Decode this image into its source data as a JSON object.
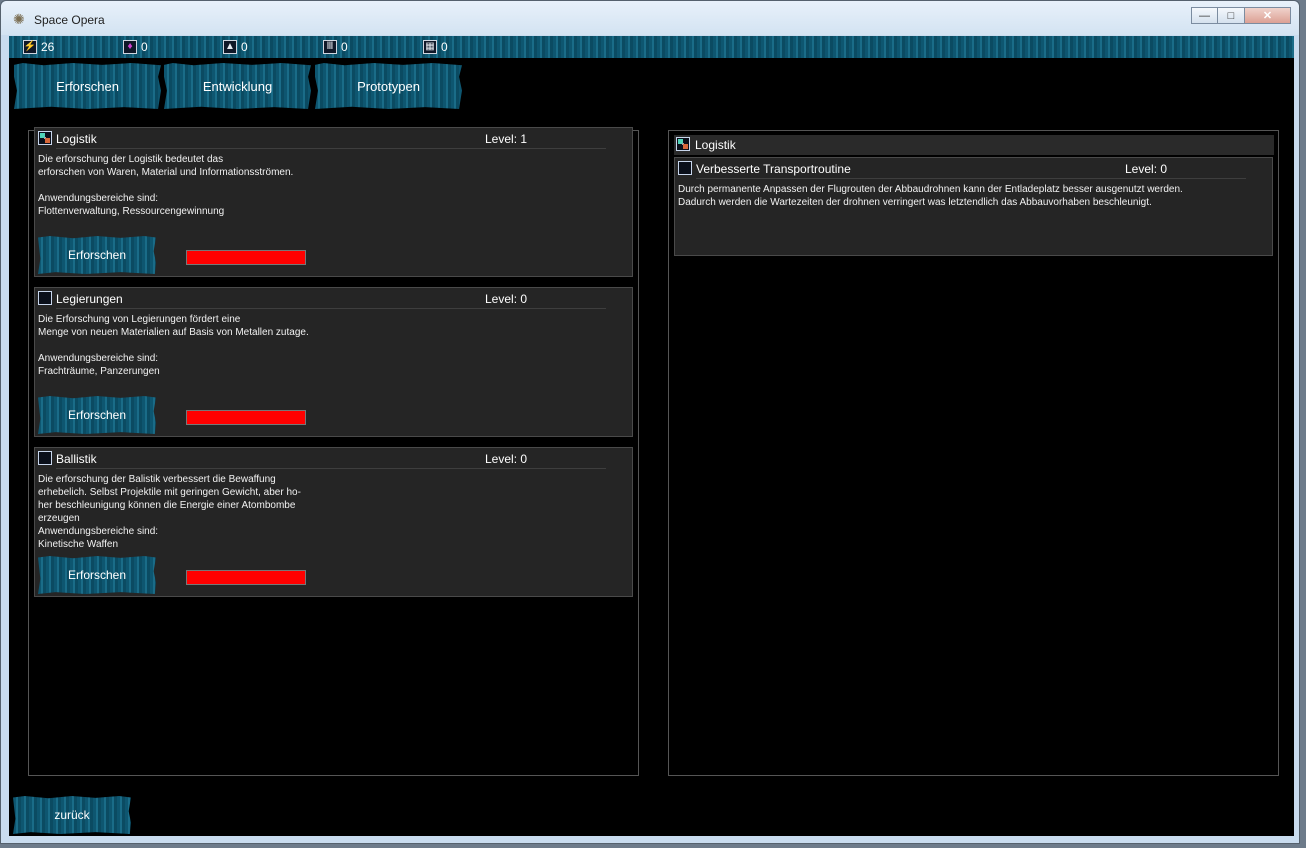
{
  "window": {
    "title": "Space Opera",
    "minimize": "—",
    "maximize": "□",
    "close": "✕"
  },
  "resources": [
    {
      "icon": "energy-icon",
      "glyph": "⚡",
      "value": "26"
    },
    {
      "icon": "crystal-icon",
      "glyph": "♦",
      "value": "0"
    },
    {
      "icon": "pyramid-icon",
      "glyph": "▲",
      "value": "0"
    },
    {
      "icon": "columns-icon",
      "glyph": "Ⅲ",
      "value": "0"
    },
    {
      "icon": "grid-icon",
      "glyph": "▦",
      "value": "0"
    }
  ],
  "tabs": [
    "Erforschen",
    "Entwicklung",
    "Prototypen"
  ],
  "research": [
    {
      "title": "Logistik",
      "level": "Level: 1",
      "checked": true,
      "desc": "Die erforschung der Logistik bedeutet das\nerforschen von Waren, Material und Informationsströmen.\n\nAnwendungsbereiche sind:\nFlottenverwaltung, Ressourcengewinnung",
      "button": "Erforschen"
    },
    {
      "title": "Legierungen",
      "level": "Level: 0",
      "checked": false,
      "desc": "Die Erforschung von Legierungen fördert eine\nMenge von neuen Materialien auf Basis von Metallen zutage.\n\nAnwendungsbereiche sind:\nFrachträume, Panzerungen",
      "button": "Erforschen"
    },
    {
      "title": "Ballistik",
      "level": "Level: 0",
      "checked": false,
      "desc": "Die erforschung der Balistik verbessert die Bewaffung\nerhebelich. Selbst Projektile mit geringen Gewicht, aber ho-\nher beschleunigung können die Energie einer Atombombe\nerzeugen\nAnwendungsbereiche sind:\nKinetische Waffen",
      "button": "Erforschen"
    }
  ],
  "detail": {
    "header": "Logistik",
    "sub": {
      "title": "Verbesserte Transportroutine",
      "level": "Level: 0",
      "desc": "Durch permanente Anpassen der Flugrouten der Abbaudrohnen kann der Entladeplatz besser ausgenutzt werden.\nDadurch werden die Wartezeiten der drohnen verringert was letztendlich das Abbauvorhaben beschleunigt."
    }
  },
  "back": "zurück",
  "colors": {
    "accent": "#1a6c88",
    "progress": "#ff0000"
  }
}
